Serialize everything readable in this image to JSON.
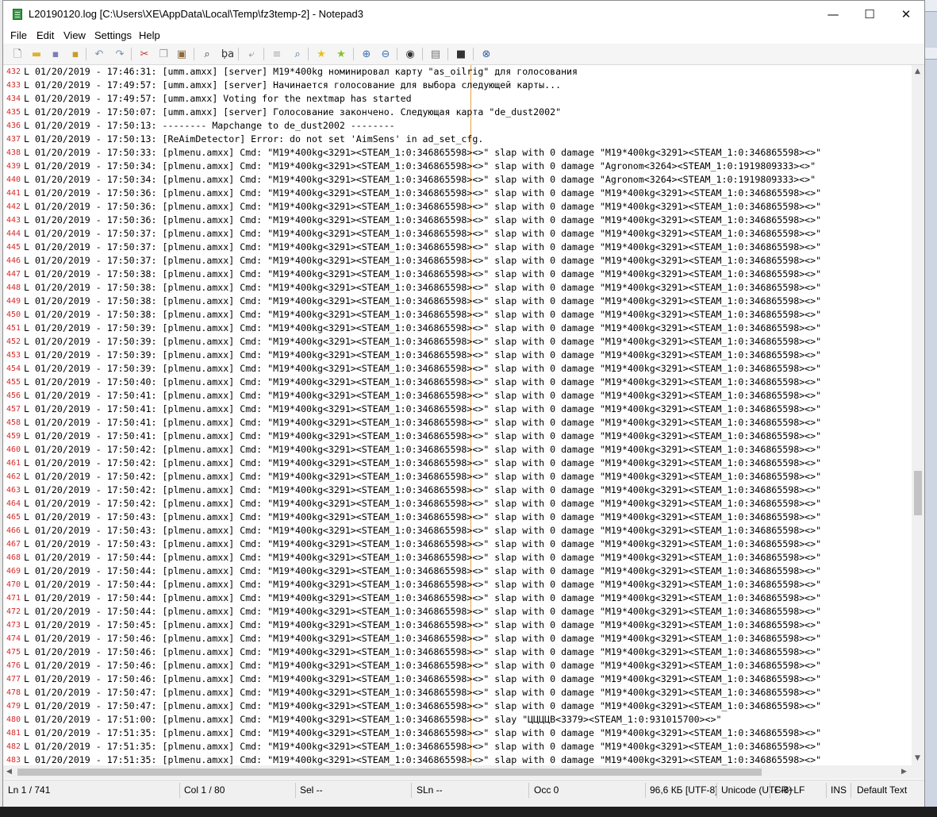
{
  "window": {
    "title": "L20190120.log [C:\\Users\\XE\\AppData\\Local\\Temp\\fz3temp-2] - Notepad3",
    "minimize_glyph": "—",
    "maximize_glyph": "☐",
    "close_glyph": "✕"
  },
  "menu": [
    "File",
    "Edit",
    "View",
    "Settings",
    "Help"
  ],
  "toolbar": {
    "icons": [
      {
        "name": "new-file-icon",
        "glyph": "🗋",
        "color": "#5a6b80"
      },
      {
        "name": "open-folder-icon",
        "glyph": "▬",
        "color": "#e0b030"
      },
      {
        "name": "save-icon",
        "glyph": "▪",
        "color": "#7a7fb8"
      },
      {
        "name": "save-as-icon",
        "glyph": "▪",
        "color": "#c99b2a"
      },
      {
        "name": "undo-icon",
        "glyph": "↶",
        "color": "#7d8fb0"
      },
      {
        "name": "redo-icon",
        "glyph": "↷",
        "color": "#7d8fb0"
      },
      {
        "name": "cut-icon",
        "glyph": "✂",
        "color": "#c0392b"
      },
      {
        "name": "copy-icon",
        "glyph": "❐",
        "color": "#a0a0a0"
      },
      {
        "name": "paste-icon",
        "glyph": "▣",
        "color": "#8b6a3c"
      },
      {
        "name": "find-icon",
        "glyph": "⌕",
        "color": "#333333"
      },
      {
        "name": "replace-icon",
        "glyph": "ḅa",
        "color": "#333333"
      },
      {
        "name": "goto-line-icon",
        "glyph": "⤶",
        "color": "#888888"
      },
      {
        "name": "word-wrap-icon",
        "glyph": "≡",
        "color": "#aaaaaa"
      },
      {
        "name": "find-in-files-icon",
        "glyph": "⌕",
        "color": "#4a6fa5"
      },
      {
        "name": "add-favorite-icon",
        "glyph": "★",
        "color": "#e8c21a"
      },
      {
        "name": "favorites-icon",
        "glyph": "★",
        "color": "#8cbf2a"
      },
      {
        "name": "zoom-in-icon",
        "glyph": "⊕",
        "color": "#3b6fb6"
      },
      {
        "name": "zoom-out-icon",
        "glyph": "⊖",
        "color": "#3b6fb6"
      },
      {
        "name": "view-icon",
        "glyph": "◉",
        "color": "#333333"
      },
      {
        "name": "scheme-icon",
        "glyph": "▤",
        "color": "#777777"
      },
      {
        "name": "console-icon",
        "glyph": "■",
        "color": "#333333"
      },
      {
        "name": "close-doc-icon",
        "glyph": "⊗",
        "color": "#2c5aa0"
      }
    ]
  },
  "editor": {
    "lines": [
      {
        "n": "432",
        "text": "L 01/20/2019 - 17:46:31: [umm.amxx] [server] M19*400kg номинировал карту \"as_oilrig\" для голосования"
      },
      {
        "n": "433",
        "text": "L 01/20/2019 - 17:49:57: [umm.amxx] [server] Начинается голосование для выбора следующей карты..."
      },
      {
        "n": "434",
        "text": "L 01/20/2019 - 17:49:57: [umm.amxx] Voting for the nextmap has started"
      },
      {
        "n": "435",
        "text": "L 01/20/2019 - 17:50:07: [umm.amxx] [server] Голосование закончено. Следующая карта \"de_dust2002\""
      },
      {
        "n": "436",
        "text": "L 01/20/2019 - 17:50:13: -------- Mapchange to de_dust2002 --------"
      },
      {
        "n": "437",
        "text": "L 01/20/2019 - 17:50:13: [ReAimDetector] Error: do not set 'AimSens' in ad_set_cfg."
      },
      {
        "n": "438",
        "text": "L 01/20/2019 - 17:50:33: [plmenu.amxx] Cmd: \"M19*400kg<3291><STEAM_1:0:346865598><>\" slap with 0 damage \"M19*400kg<3291><STEAM_1:0:346865598><>\""
      },
      {
        "n": "439",
        "text": "L 01/20/2019 - 17:50:34: [plmenu.amxx] Cmd: \"M19*400kg<3291><STEAM_1:0:346865598><>\" slap with 0 damage \"Agronom<3264><STEAM_1:0:1919809333><>\""
      },
      {
        "n": "440",
        "text": "L 01/20/2019 - 17:50:34: [plmenu.amxx] Cmd: \"M19*400kg<3291><STEAM_1:0:346865598><>\" slap with 0 damage \"Agronom<3264><STEAM_1:0:1919809333><>\""
      },
      {
        "n": "441",
        "text": "L 01/20/2019 - 17:50:36: [plmenu.amxx] Cmd: \"M19*400kg<3291><STEAM_1:0:346865598><>\" slap with 0 damage \"M19*400kg<3291><STEAM_1:0:346865598><>\""
      },
      {
        "n": "442",
        "text": "L 01/20/2019 - 17:50:36: [plmenu.amxx] Cmd: \"M19*400kg<3291><STEAM_1:0:346865598><>\" slap with 0 damage \"M19*400kg<3291><STEAM_1:0:346865598><>\""
      },
      {
        "n": "443",
        "text": "L 01/20/2019 - 17:50:36: [plmenu.amxx] Cmd: \"M19*400kg<3291><STEAM_1:0:346865598><>\" slap with 0 damage \"M19*400kg<3291><STEAM_1:0:346865598><>\""
      },
      {
        "n": "444",
        "text": "L 01/20/2019 - 17:50:37: [plmenu.amxx] Cmd: \"M19*400kg<3291><STEAM_1:0:346865598><>\" slap with 0 damage \"M19*400kg<3291><STEAM_1:0:346865598><>\""
      },
      {
        "n": "445",
        "text": "L 01/20/2019 - 17:50:37: [plmenu.amxx] Cmd: \"M19*400kg<3291><STEAM_1:0:346865598><>\" slap with 0 damage \"M19*400kg<3291><STEAM_1:0:346865598><>\""
      },
      {
        "n": "446",
        "text": "L 01/20/2019 - 17:50:37: [plmenu.amxx] Cmd: \"M19*400kg<3291><STEAM_1:0:346865598><>\" slap with 0 damage \"M19*400kg<3291><STEAM_1:0:346865598><>\""
      },
      {
        "n": "447",
        "text": "L 01/20/2019 - 17:50:38: [plmenu.amxx] Cmd: \"M19*400kg<3291><STEAM_1:0:346865598><>\" slap with 0 damage \"M19*400kg<3291><STEAM_1:0:346865598><>\""
      },
      {
        "n": "448",
        "text": "L 01/20/2019 - 17:50:38: [plmenu.amxx] Cmd: \"M19*400kg<3291><STEAM_1:0:346865598><>\" slap with 0 damage \"M19*400kg<3291><STEAM_1:0:346865598><>\""
      },
      {
        "n": "449",
        "text": "L 01/20/2019 - 17:50:38: [plmenu.amxx] Cmd: \"M19*400kg<3291><STEAM_1:0:346865598><>\" slap with 0 damage \"M19*400kg<3291><STEAM_1:0:346865598><>\""
      },
      {
        "n": "450",
        "text": "L 01/20/2019 - 17:50:38: [plmenu.amxx] Cmd: \"M19*400kg<3291><STEAM_1:0:346865598><>\" slap with 0 damage \"M19*400kg<3291><STEAM_1:0:346865598><>\""
      },
      {
        "n": "451",
        "text": "L 01/20/2019 - 17:50:39: [plmenu.amxx] Cmd: \"M19*400kg<3291><STEAM_1:0:346865598><>\" slap with 0 damage \"M19*400kg<3291><STEAM_1:0:346865598><>\""
      },
      {
        "n": "452",
        "text": "L 01/20/2019 - 17:50:39: [plmenu.amxx] Cmd: \"M19*400kg<3291><STEAM_1:0:346865598><>\" slap with 0 damage \"M19*400kg<3291><STEAM_1:0:346865598><>\""
      },
      {
        "n": "453",
        "text": "L 01/20/2019 - 17:50:39: [plmenu.amxx] Cmd: \"M19*400kg<3291><STEAM_1:0:346865598><>\" slap with 0 damage \"M19*400kg<3291><STEAM_1:0:346865598><>\""
      },
      {
        "n": "454",
        "text": "L 01/20/2019 - 17:50:39: [plmenu.amxx] Cmd: \"M19*400kg<3291><STEAM_1:0:346865598><>\" slap with 0 damage \"M19*400kg<3291><STEAM_1:0:346865598><>\""
      },
      {
        "n": "455",
        "text": "L 01/20/2019 - 17:50:40: [plmenu.amxx] Cmd: \"M19*400kg<3291><STEAM_1:0:346865598><>\" slap with 0 damage \"M19*400kg<3291><STEAM_1:0:346865598><>\""
      },
      {
        "n": "456",
        "text": "L 01/20/2019 - 17:50:41: [plmenu.amxx] Cmd: \"M19*400kg<3291><STEAM_1:0:346865598><>\" slap with 0 damage \"M19*400kg<3291><STEAM_1:0:346865598><>\""
      },
      {
        "n": "457",
        "text": "L 01/20/2019 - 17:50:41: [plmenu.amxx] Cmd: \"M19*400kg<3291><STEAM_1:0:346865598><>\" slap with 0 damage \"M19*400kg<3291><STEAM_1:0:346865598><>\""
      },
      {
        "n": "458",
        "text": "L 01/20/2019 - 17:50:41: [plmenu.amxx] Cmd: \"M19*400kg<3291><STEAM_1:0:346865598><>\" slap with 0 damage \"M19*400kg<3291><STEAM_1:0:346865598><>\""
      },
      {
        "n": "459",
        "text": "L 01/20/2019 - 17:50:41: [plmenu.amxx] Cmd: \"M19*400kg<3291><STEAM_1:0:346865598><>\" slap with 0 damage \"M19*400kg<3291><STEAM_1:0:346865598><>\""
      },
      {
        "n": "460",
        "text": "L 01/20/2019 - 17:50:42: [plmenu.amxx] Cmd: \"M19*400kg<3291><STEAM_1:0:346865598><>\" slap with 0 damage \"M19*400kg<3291><STEAM_1:0:346865598><>\""
      },
      {
        "n": "461",
        "text": "L 01/20/2019 - 17:50:42: [plmenu.amxx] Cmd: \"M19*400kg<3291><STEAM_1:0:346865598><>\" slap with 0 damage \"M19*400kg<3291><STEAM_1:0:346865598><>\""
      },
      {
        "n": "462",
        "text": "L 01/20/2019 - 17:50:42: [plmenu.amxx] Cmd: \"M19*400kg<3291><STEAM_1:0:346865598><>\" slap with 0 damage \"M19*400kg<3291><STEAM_1:0:346865598><>\""
      },
      {
        "n": "463",
        "text": "L 01/20/2019 - 17:50:42: [plmenu.amxx] Cmd: \"M19*400kg<3291><STEAM_1:0:346865598><>\" slap with 0 damage \"M19*400kg<3291><STEAM_1:0:346865598><>\""
      },
      {
        "n": "464",
        "text": "L 01/20/2019 - 17:50:42: [plmenu.amxx] Cmd: \"M19*400kg<3291><STEAM_1:0:346865598><>\" slap with 0 damage \"M19*400kg<3291><STEAM_1:0:346865598><>\""
      },
      {
        "n": "465",
        "text": "L 01/20/2019 - 17:50:43: [plmenu.amxx] Cmd: \"M19*400kg<3291><STEAM_1:0:346865598><>\" slap with 0 damage \"M19*400kg<3291><STEAM_1:0:346865598><>\""
      },
      {
        "n": "466",
        "text": "L 01/20/2019 - 17:50:43: [plmenu.amxx] Cmd: \"M19*400kg<3291><STEAM_1:0:346865598><>\" slap with 0 damage \"M19*400kg<3291><STEAM_1:0:346865598><>\""
      },
      {
        "n": "467",
        "text": "L 01/20/2019 - 17:50:43: [plmenu.amxx] Cmd: \"M19*400kg<3291><STEAM_1:0:346865598><>\" slap with 0 damage \"M19*400kg<3291><STEAM_1:0:346865598><>\""
      },
      {
        "n": "468",
        "text": "L 01/20/2019 - 17:50:44: [plmenu.amxx] Cmd: \"M19*400kg<3291><STEAM_1:0:346865598><>\" slap with 0 damage \"M19*400kg<3291><STEAM_1:0:346865598><>\""
      },
      {
        "n": "469",
        "text": "L 01/20/2019 - 17:50:44: [plmenu.amxx] Cmd: \"M19*400kg<3291><STEAM_1:0:346865598><>\" slap with 0 damage \"M19*400kg<3291><STEAM_1:0:346865598><>\""
      },
      {
        "n": "470",
        "text": "L 01/20/2019 - 17:50:44: [plmenu.amxx] Cmd: \"M19*400kg<3291><STEAM_1:0:346865598><>\" slap with 0 damage \"M19*400kg<3291><STEAM_1:0:346865598><>\""
      },
      {
        "n": "471",
        "text": "L 01/20/2019 - 17:50:44: [plmenu.amxx] Cmd: \"M19*400kg<3291><STEAM_1:0:346865598><>\" slap with 0 damage \"M19*400kg<3291><STEAM_1:0:346865598><>\""
      },
      {
        "n": "472",
        "text": "L 01/20/2019 - 17:50:44: [plmenu.amxx] Cmd: \"M19*400kg<3291><STEAM_1:0:346865598><>\" slap with 0 damage \"M19*400kg<3291><STEAM_1:0:346865598><>\""
      },
      {
        "n": "473",
        "text": "L 01/20/2019 - 17:50:45: [plmenu.amxx] Cmd: \"M19*400kg<3291><STEAM_1:0:346865598><>\" slap with 0 damage \"M19*400kg<3291><STEAM_1:0:346865598><>\""
      },
      {
        "n": "474",
        "text": "L 01/20/2019 - 17:50:46: [plmenu.amxx] Cmd: \"M19*400kg<3291><STEAM_1:0:346865598><>\" slap with 0 damage \"M19*400kg<3291><STEAM_1:0:346865598><>\""
      },
      {
        "n": "475",
        "text": "L 01/20/2019 - 17:50:46: [plmenu.amxx] Cmd: \"M19*400kg<3291><STEAM_1:0:346865598><>\" slap with 0 damage \"M19*400kg<3291><STEAM_1:0:346865598><>\""
      },
      {
        "n": "476",
        "text": "L 01/20/2019 - 17:50:46: [plmenu.amxx] Cmd: \"M19*400kg<3291><STEAM_1:0:346865598><>\" slap with 0 damage \"M19*400kg<3291><STEAM_1:0:346865598><>\""
      },
      {
        "n": "477",
        "text": "L 01/20/2019 - 17:50:46: [plmenu.amxx] Cmd: \"M19*400kg<3291><STEAM_1:0:346865598><>\" slap with 0 damage \"M19*400kg<3291><STEAM_1:0:346865598><>\""
      },
      {
        "n": "478",
        "text": "L 01/20/2019 - 17:50:47: [plmenu.amxx] Cmd: \"M19*400kg<3291><STEAM_1:0:346865598><>\" slap with 0 damage \"M19*400kg<3291><STEAM_1:0:346865598><>\""
      },
      {
        "n": "479",
        "text": "L 01/20/2019 - 17:50:47: [plmenu.amxx] Cmd: \"M19*400kg<3291><STEAM_1:0:346865598><>\" slap with 0 damage \"M19*400kg<3291><STEAM_1:0:346865598><>\""
      },
      {
        "n": "480",
        "text": "L 01/20/2019 - 17:51:00: [plmenu.amxx] Cmd: \"M19*400kg<3291><STEAM_1:0:346865598><>\" slay \"ЦЦЦЦВ<3379><STEAM_1:0:931015700><>\""
      },
      {
        "n": "481",
        "text": "L 01/20/2019 - 17:51:35: [plmenu.amxx] Cmd: \"M19*400kg<3291><STEAM_1:0:346865598><>\" slap with 0 damage \"M19*400kg<3291><STEAM_1:0:346865598><>\""
      },
      {
        "n": "482",
        "text": "L 01/20/2019 - 17:51:35: [plmenu.amxx] Cmd: \"M19*400kg<3291><STEAM_1:0:346865598><>\" slap with 0 damage \"M19*400kg<3291><STEAM_1:0:346865598><>\""
      },
      {
        "n": "483",
        "text": "L 01/20/2019 - 17:51:35: [plmenu.amxx] Cmd: \"M19*400kg<3291><STEAM_1:0:346865598><>\" slap with 0 damage \"M19*400kg<3291><STEAM_1:0:346865598><>\""
      }
    ]
  },
  "scrollbar": {
    "up_glyph": "▲",
    "down_glyph": "▼",
    "left_glyph": "◀",
    "right_glyph": "▶"
  },
  "status": {
    "line": "Ln  1 / 741",
    "col": "Col  1 / 80",
    "sel": "Sel  --",
    "sln": "SLn  --",
    "occ": "Occ  0",
    "size": "96,6 КБ [UTF-8]",
    "encoding": "Unicode (UTF-8)",
    "eol": "CR+LF",
    "ins": "INS",
    "scheme": "Default Text"
  }
}
